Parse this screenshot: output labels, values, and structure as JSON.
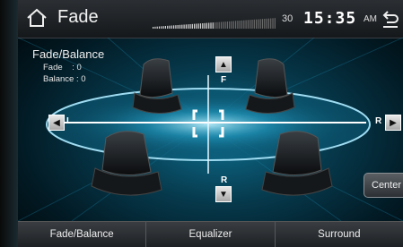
{
  "header": {
    "title": "Fade",
    "volume_value": "30",
    "clock": "15:35",
    "ampm": "AM"
  },
  "info": {
    "title": "Fade/Balance",
    "fade_line": "Fade    : 0",
    "balance_line": "Balance : 0"
  },
  "axis": {
    "front": "F",
    "rear": "R",
    "left": "L",
    "right": "R"
  },
  "center_button": "Center",
  "tabs": [
    {
      "label": "Fade/Balance"
    },
    {
      "label": "Equalizer"
    },
    {
      "label": "Surround"
    }
  ],
  "colors": {
    "accent": "#bfe6ff",
    "background": "#06394c"
  }
}
